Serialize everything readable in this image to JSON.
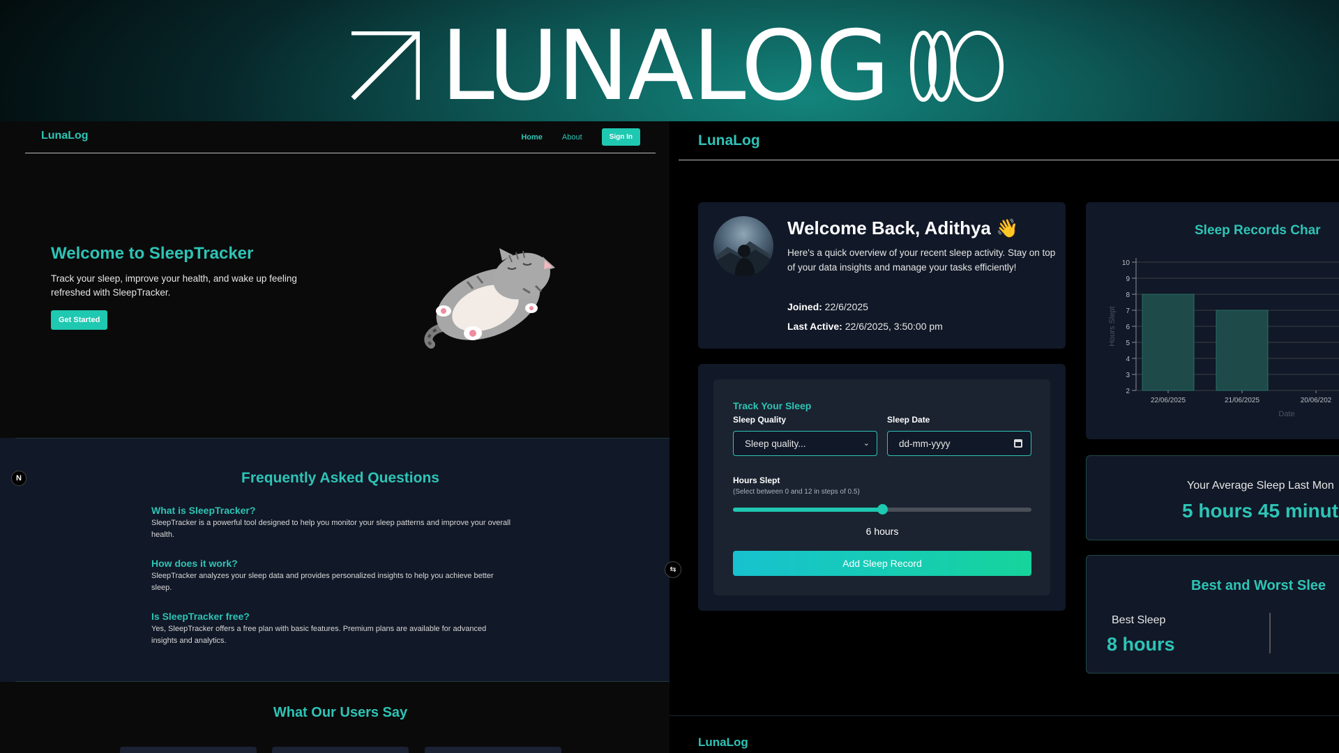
{
  "banner": {
    "wordmark": "LUNALOG",
    "arrow_icon": "arrow-up-right-icon",
    "rings_icon": "interlocked-rings-icon"
  },
  "landing": {
    "brand": "LunaLog",
    "nav": {
      "home": "Home",
      "about": "About",
      "sign_in": "Sign In"
    },
    "hero": {
      "title": "Welcome to SleepTracker",
      "text": "Track your sleep, improve your health, and wake up feeling refreshed with SleepTracker.",
      "cta": "Get Started",
      "illustration": "sleeping-cat-icon"
    },
    "badge": "N",
    "faq": {
      "title": "Frequently Asked Questions",
      "items": [
        {
          "q": "What is SleepTracker?",
          "a": "SleepTracker is a powerful tool designed to help you monitor your sleep patterns and improve your overall health."
        },
        {
          "q": "How does it work?",
          "a": "SleepTracker analyzes your sleep data and provides personalized insights to help you achieve better sleep."
        },
        {
          "q": "Is SleepTracker free?",
          "a": "Yes, SleepTracker offers a free plan with basic features. Premium plans are available for advanced insights and analytics."
        }
      ]
    },
    "testimonials_title": "What Our Users Say"
  },
  "dashboard": {
    "brand": "LunaLog",
    "welcome": {
      "title": "Welcome Back, Adithya",
      "emoji": "👋",
      "text": "Here's a quick overview of your recent sleep activity. Stay on top of your data insights and manage your tasks efficiently!",
      "joined_label": "Joined:",
      "joined_value": "22/6/2025",
      "last_active_label": "Last Active:",
      "last_active_value": "22/6/2025, 3:50:00 pm"
    },
    "track": {
      "title": "Track Your Sleep",
      "quality_label": "Sleep Quality",
      "quality_placeholder": "Sleep quality...",
      "date_label": "Sleep Date",
      "date_placeholder": "dd-mm-yyyy",
      "hours_label": "Hours Slept",
      "hours_hint": "(Select between 0 and 12 in steps of 0.5)",
      "hours_value": 6,
      "hours_max": 12,
      "hours_display": "6 hours",
      "submit": "Add Sleep Record"
    },
    "average": {
      "label": "Your Average Sleep Last Mon",
      "value": "5 hours 45 minut"
    },
    "best_worst": {
      "title": "Best and Worst Slee",
      "best_label": "Best Sleep",
      "best_value": "8 hours"
    },
    "footer_brand": "LunaLog"
  },
  "chart_data": {
    "type": "bar",
    "title": "Sleep Records Char",
    "xlabel": "Date",
    "ylabel": "Hours Slept",
    "categories": [
      "22/06/2025",
      "21/06/2025",
      "20/06/202"
    ],
    "values": [
      8,
      7,
      null
    ],
    "ylim": [
      2,
      10
    ],
    "yticks": [
      2,
      3,
      4,
      5,
      6,
      7,
      8,
      9,
      10
    ],
    "grid": true,
    "bar_color": "#1e4a49",
    "bar_edge": "#2a6e69"
  },
  "colors": {
    "accent": "#2ec4b6",
    "card_bg": "#111827",
    "button_gradient_start": "#17c2cf",
    "button_gradient_end": "#16d49c"
  }
}
